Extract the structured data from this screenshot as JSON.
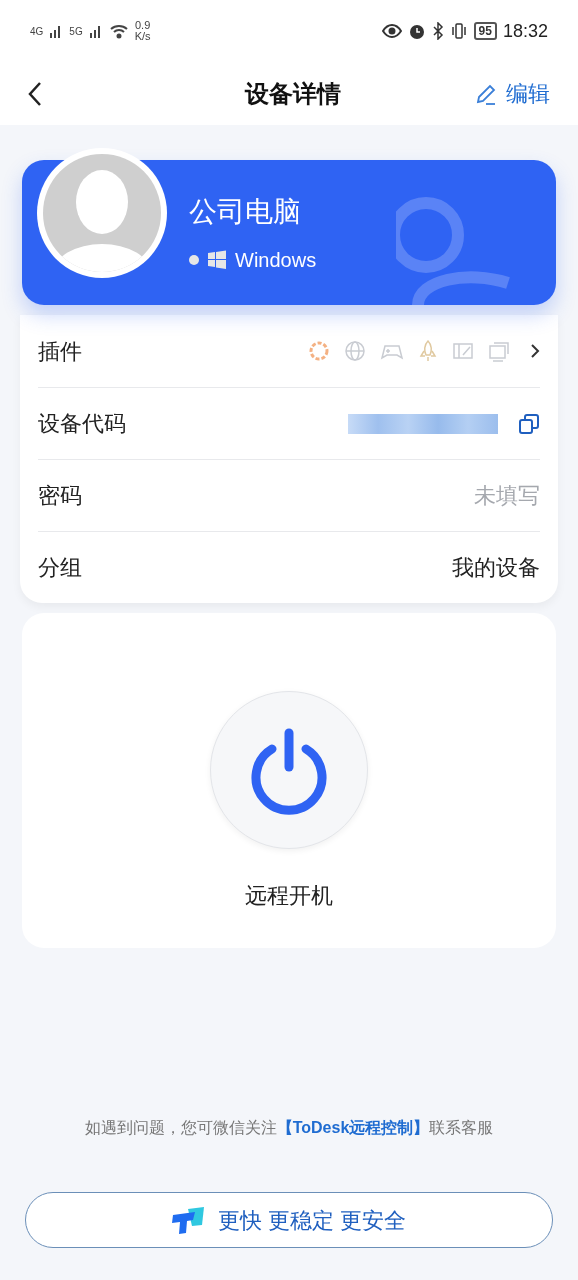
{
  "status_bar": {
    "network_1": "4G",
    "network_2": "5G",
    "net_speed": "0.9",
    "net_unit": "K/s",
    "battery": "95",
    "time": "18:32"
  },
  "header": {
    "title": "设备详情",
    "edit": "编辑"
  },
  "device": {
    "name": "公司电脑",
    "online": false,
    "os": "Windows"
  },
  "rows": [
    {
      "kind": "plugins",
      "label": "插件"
    },
    {
      "kind": "code",
      "label": "设备代码"
    },
    {
      "kind": "value",
      "label": "密码",
      "value": "未填写",
      "empty": true
    },
    {
      "kind": "value",
      "label": "分组",
      "value": "我的设备",
      "empty": false
    }
  ],
  "power": {
    "label": "远程开机"
  },
  "footer": {
    "prefix": "如遇到问题，您可微信关注",
    "link": "【ToDesk远程控制】",
    "suffix": "联系客服"
  },
  "banner": {
    "text": "更快 更稳定 更安全"
  }
}
